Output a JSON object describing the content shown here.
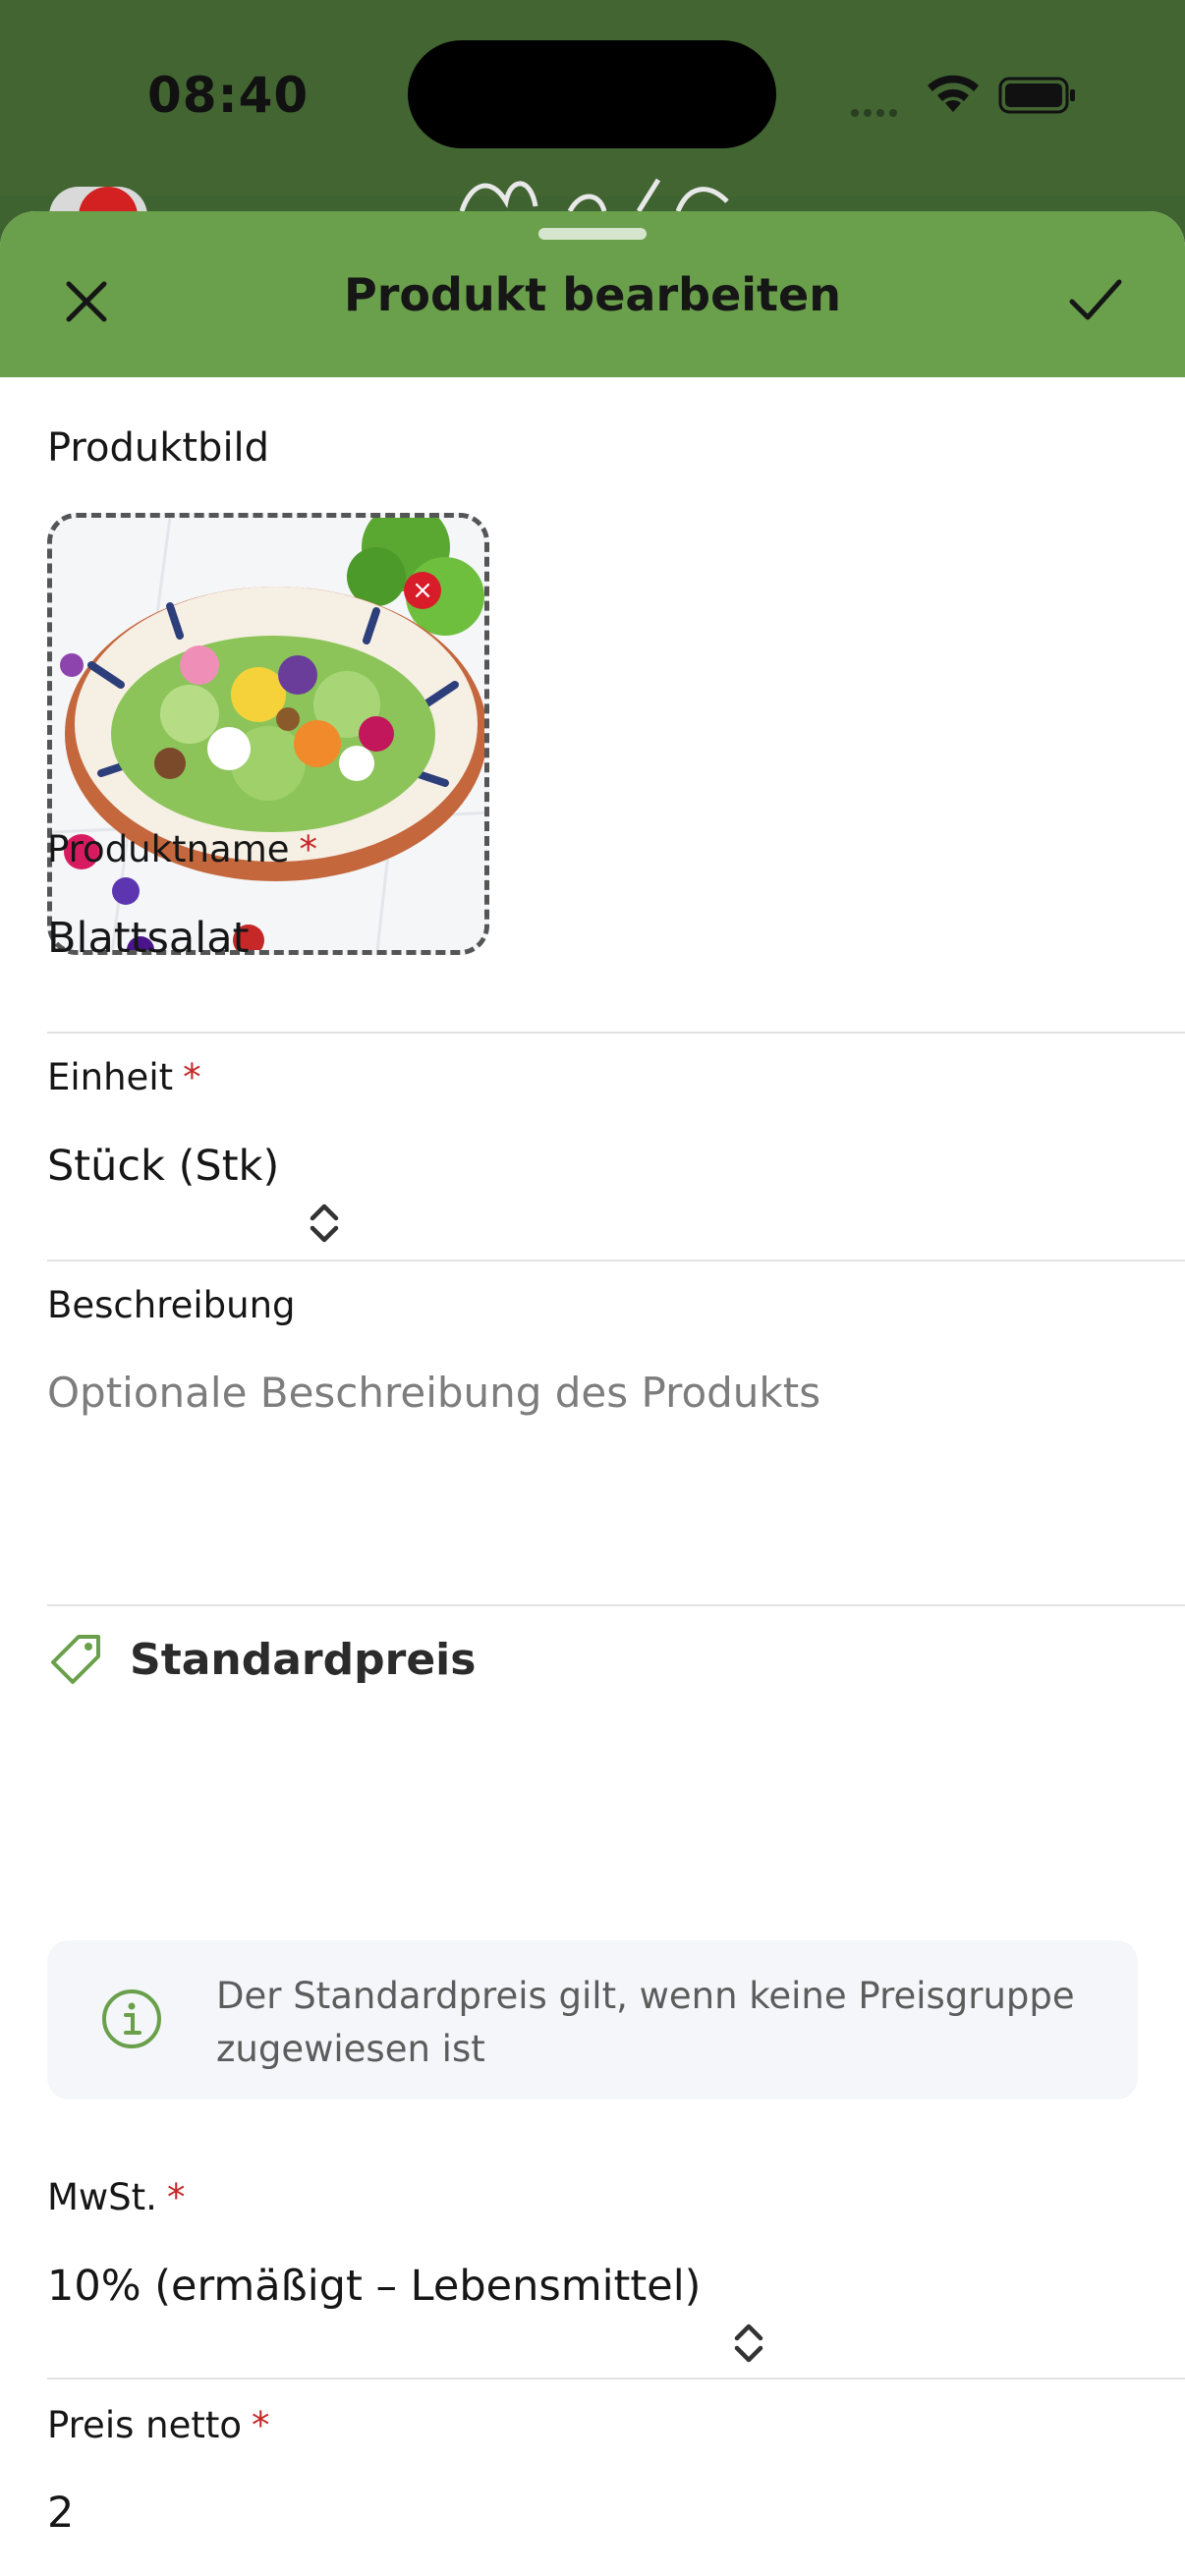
{
  "status_bar": {
    "time": "08:40"
  },
  "sheet": {
    "title": "Produkt bearbeiten",
    "close_icon": "close-icon",
    "confirm_icon": "checkmark-icon"
  },
  "image_section": {
    "label": "Produktbild",
    "image_alt": "salad-bowl-photo",
    "remove_icon": "remove-icon"
  },
  "fields": {
    "name": {
      "label": "Produktname",
      "required_mark": "*",
      "value": "Blattsalat"
    },
    "unit": {
      "label": "Einheit",
      "required_mark": "*",
      "value": "Stück (Stk)"
    },
    "description": {
      "label": "Beschreibung",
      "placeholder": "Optionale Beschreibung des Produkts"
    }
  },
  "standard_price": {
    "title": "Standardpreis",
    "info": "Der Standardpreis gilt, wenn keine Preisgruppe zugewiesen ist",
    "vat": {
      "label": "MwSt.",
      "required_mark": "*",
      "value": "10% (ermäßigt – Lebensmittel)"
    },
    "net_price": {
      "label": "Preis netto",
      "required_mark": "*",
      "value": "2"
    }
  },
  "colors": {
    "header_green": "#6aa04b",
    "status_green": "#426532",
    "required_red": "#c62828",
    "accent_green": "#6aa04b"
  }
}
